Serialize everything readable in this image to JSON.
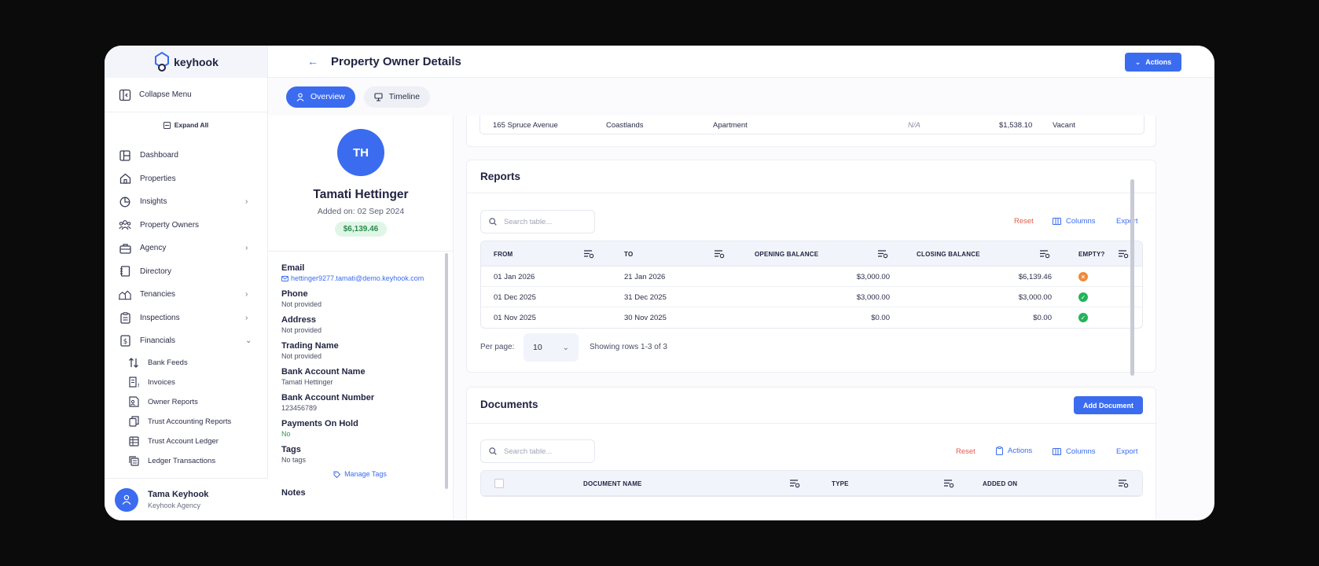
{
  "brand": {
    "name": "keyhook"
  },
  "sidebar": {
    "collapse_label": "Collapse Menu",
    "expand_all_label": "Expand All",
    "items": [
      {
        "label": "Dashboard",
        "icon": "dashboard-icon",
        "has_chevron": false
      },
      {
        "label": "Properties",
        "icon": "home-icon",
        "has_chevron": false
      },
      {
        "label": "Insights",
        "icon": "pie-chart-icon",
        "has_chevron": true
      },
      {
        "label": "Property Owners",
        "icon": "users-icon",
        "has_chevron": false
      },
      {
        "label": "Agency",
        "icon": "briefcase-icon",
        "has_chevron": true
      },
      {
        "label": "Directory",
        "icon": "book-icon",
        "has_chevron": false
      },
      {
        "label": "Tenancies",
        "icon": "buildings-icon",
        "has_chevron": true
      },
      {
        "label": "Inspections",
        "icon": "clipboard-icon",
        "has_chevron": true
      },
      {
        "label": "Financials",
        "icon": "dollar-doc-icon",
        "has_chevron": true,
        "expanded": true
      }
    ],
    "sub_items": [
      {
        "label": "Bank Feeds",
        "icon": "arrows-updown-icon"
      },
      {
        "label": "Invoices",
        "icon": "invoice-icon"
      },
      {
        "label": "Owner Reports",
        "icon": "owner-report-icon"
      },
      {
        "label": "Trust Accounting Reports",
        "icon": "copy-doc-icon"
      },
      {
        "label": "Trust Account Ledger",
        "icon": "ledger-icon"
      },
      {
        "label": "Ledger Transactions",
        "icon": "stack-icon"
      }
    ],
    "user": {
      "name": "Tama Keyhook",
      "org": "Keyhook Agency"
    }
  },
  "header": {
    "title": "Property Owner Details",
    "actions_label": "Actions"
  },
  "tabs": [
    {
      "label": "Overview",
      "active": true
    },
    {
      "label": "Timeline",
      "active": false
    }
  ],
  "owner": {
    "initials": "TH",
    "name": "Tamati Hettinger",
    "added": "Added on: 02 Sep 2024",
    "balance": "$6,139.46",
    "fields": [
      {
        "label": "Email",
        "value": "hettinger9277.tamati@demo.keyhook.com",
        "style": "link"
      },
      {
        "label": "Phone",
        "value": "Not provided",
        "style": ""
      },
      {
        "label": "Address",
        "value": "Not provided",
        "style": ""
      },
      {
        "label": "Trading Name",
        "value": "Not provided",
        "style": ""
      },
      {
        "label": "Bank Account Name",
        "value": "Tamati Hettinger",
        "style": ""
      },
      {
        "label": "Bank Account Number",
        "value": "123456789",
        "style": ""
      },
      {
        "label": "Payments On Hold",
        "value": "No",
        "style": "green"
      },
      {
        "label": "Tags",
        "value": "No tags",
        "style": ""
      }
    ],
    "manage_tags_label": "Manage Tags",
    "notes_label": "Notes"
  },
  "property_row": {
    "address": "165 Spruce Avenue",
    "area": "Coastlands",
    "type": "Apartment",
    "na": "N/A",
    "amount": "$1,538.10",
    "status": "Vacant"
  },
  "reports": {
    "title": "Reports",
    "search_placeholder": "Search table...",
    "reset_label": "Reset",
    "columns_label": "Columns",
    "export_label": "Export",
    "headers": [
      "FROM",
      "TO",
      "OPENING BALANCE",
      "CLOSING BALANCE",
      "EMPTY?"
    ],
    "rows": [
      {
        "from": "01 Jan 2026",
        "to": "21 Jan 2026",
        "opening": "$3,000.00",
        "closing": "$6,139.46",
        "empty": false
      },
      {
        "from": "01 Dec 2025",
        "to": "31 Dec 2025",
        "opening": "$3,000.00",
        "closing": "$3,000.00",
        "empty": true
      },
      {
        "from": "01 Nov 2025",
        "to": "30 Nov 2025",
        "opening": "$0.00",
        "closing": "$0.00",
        "empty": true
      }
    ],
    "per_page_label": "Per page:",
    "per_page_value": "10",
    "showing": "Showing rows 1-3 of 3",
    "colors": {
      "empty_yes": "#22b35a",
      "empty_no": "#f08a3c"
    }
  },
  "documents": {
    "title": "Documents",
    "add_label": "Add Document",
    "search_placeholder": "Search table...",
    "reset_label": "Reset",
    "actions_label": "Actions",
    "columns_label": "Columns",
    "export_label": "Export",
    "headers": [
      "DOCUMENT NAME",
      "TYPE",
      "ADDED ON"
    ]
  },
  "colors": {
    "accent": "#3b6cf0",
    "danger": "#e35d4f",
    "success": "#2d9a52"
  }
}
